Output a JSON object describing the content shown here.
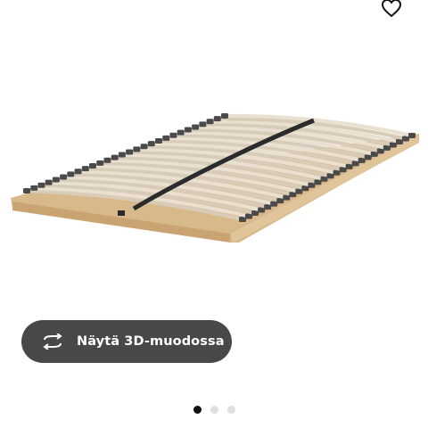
{
  "favorite": {
    "icon": "heart-outline-icon"
  },
  "product_image": {
    "alt_icon": "slatted-bed-base"
  },
  "view_3d_button": {
    "label": "Näytä 3D-muodossa",
    "icon": "rotate-3d-icon"
  },
  "carousel": {
    "count": 3,
    "active_index": 0
  },
  "colors": {
    "button_bg": "#484848",
    "dot_active": "#111111",
    "dot_inactive": "#dfdfdf"
  }
}
